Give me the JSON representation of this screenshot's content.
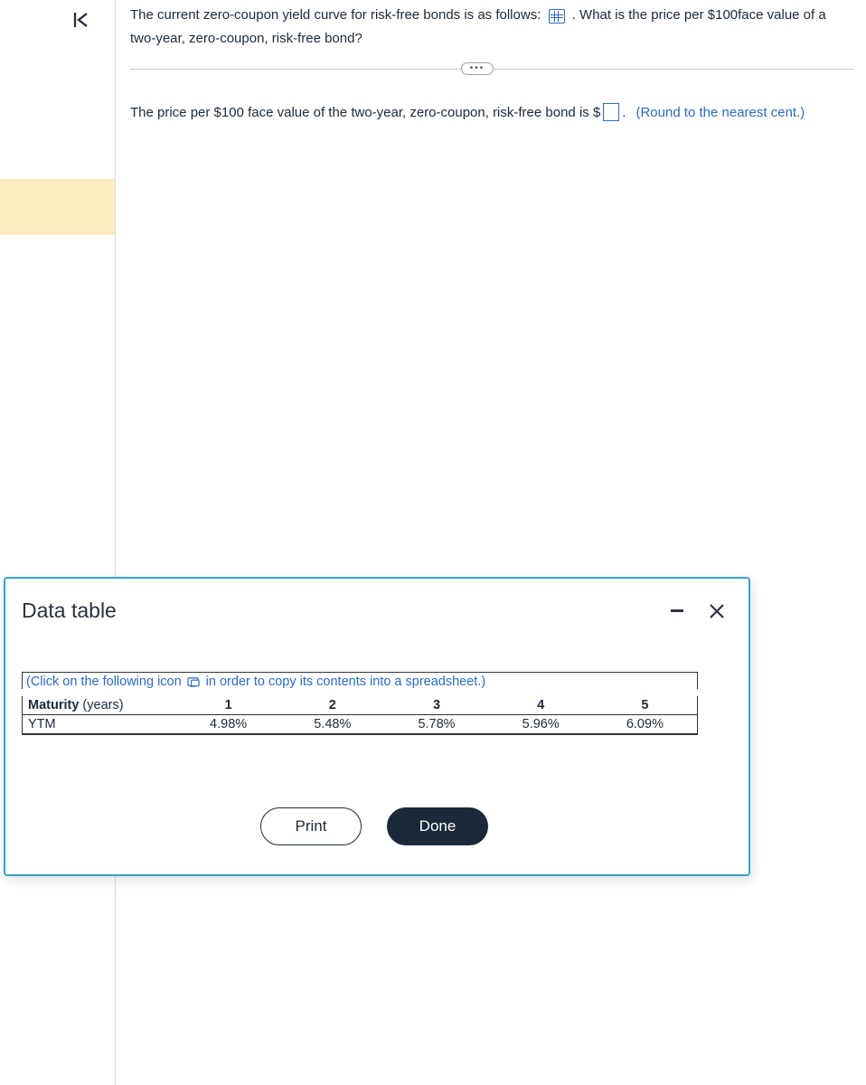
{
  "question": {
    "part1": "The current zero-coupon yield curve for risk-free bonds is as follows:",
    "part2": ". What is the price per $100face value of a two-year, zero-coupon, risk-free bond?"
  },
  "answer": {
    "lead": "The price per $100 face value of the two-year, zero-coupon, risk-free bond is $",
    "trail": ".",
    "hint": "(Round to the nearest cent.)"
  },
  "modal": {
    "title": "Data table",
    "copy_note_a": "(Click on the following icon",
    "copy_note_b": "in order to copy its contents into a spreadsheet.)",
    "row_labels": {
      "maturity": "Maturity",
      "maturity_unit": " (years)",
      "ytm": "YTM"
    },
    "print": "Print",
    "done": "Done"
  },
  "chart_data": {
    "type": "table",
    "title": "Zero-coupon yield curve",
    "columns": [
      "1",
      "2",
      "3",
      "4",
      "5"
    ],
    "rows": [
      {
        "label": "YTM",
        "values": [
          "4.98%",
          "5.48%",
          "5.78%",
          "5.96%",
          "6.09%"
        ]
      }
    ]
  }
}
